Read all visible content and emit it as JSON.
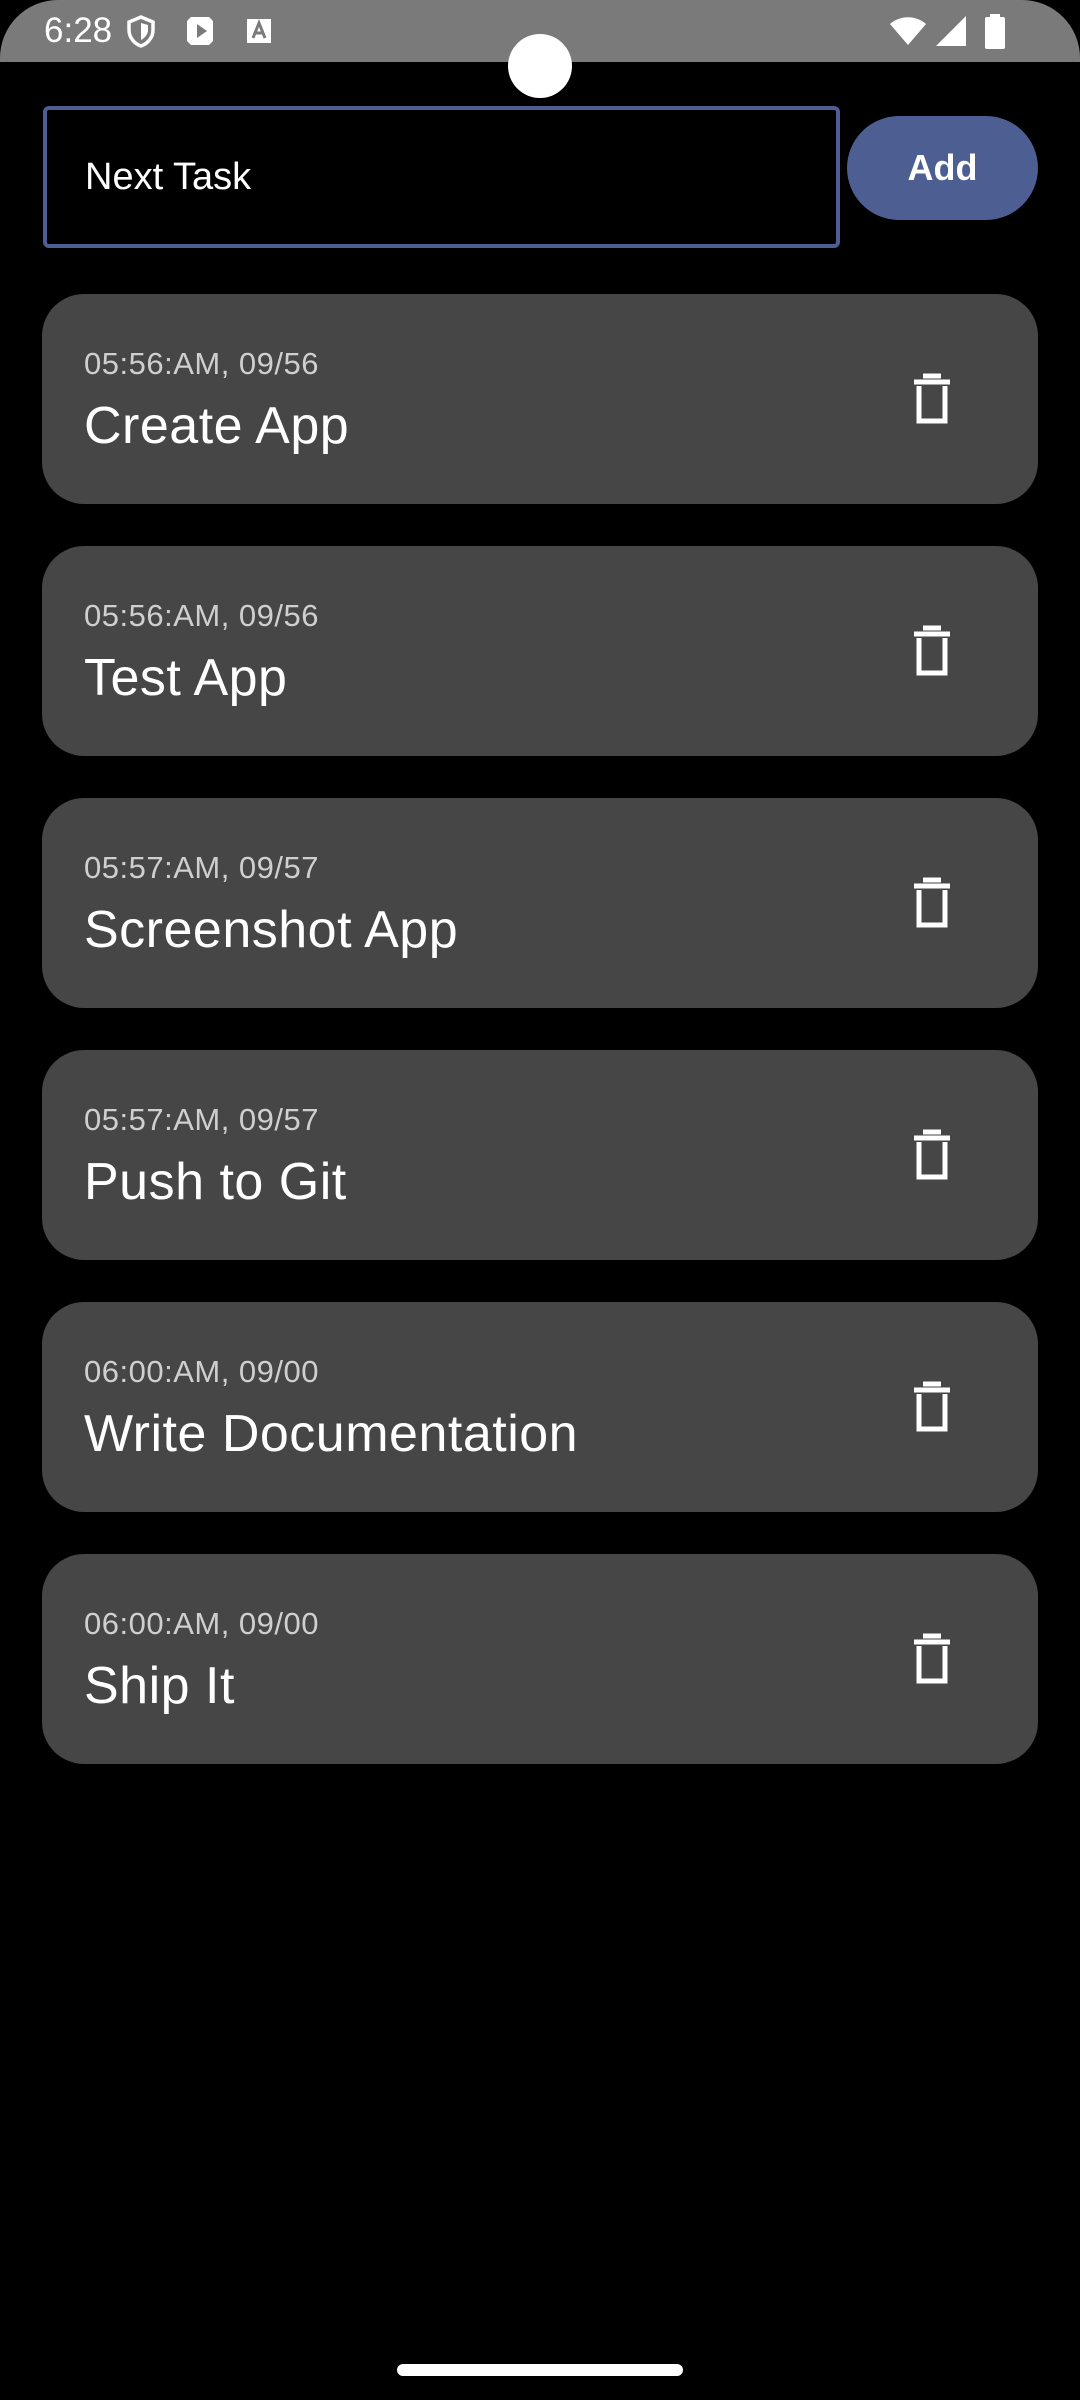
{
  "status_bar": {
    "time": "6:28",
    "icons": [
      "shield-icon",
      "play-store-icon",
      "text-a-icon",
      "wifi-icon",
      "signal-icon",
      "battery-icon"
    ]
  },
  "input": {
    "value": "Next Task",
    "placeholder": ""
  },
  "add_button": {
    "label": "Add"
  },
  "tasks": [
    {
      "time": "05:56:AM, 09/56",
      "title": "Create App"
    },
    {
      "time": "05:56:AM, 09/56",
      "title": "Test App"
    },
    {
      "time": "05:57:AM, 09/57",
      "title": "Screenshot App"
    },
    {
      "time": "05:57:AM, 09/57",
      "title": "Push to Git"
    },
    {
      "time": "06:00:AM, 09/00",
      "title": "Write Documentation"
    },
    {
      "time": "06:00:AM, 09/00",
      "title": "Ship It"
    }
  ],
  "colors": {
    "accent": "#4d5e93",
    "card": "#464646",
    "status_bar": "#7a7a7a",
    "background": "#000000"
  }
}
